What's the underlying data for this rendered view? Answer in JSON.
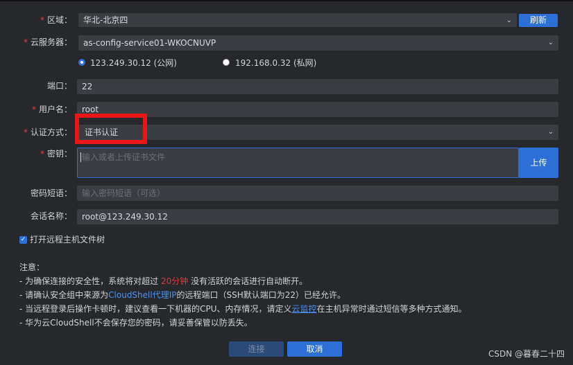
{
  "form": {
    "region": {
      "label": "区域：",
      "value": "华北-北京四",
      "refresh": "刷新"
    },
    "server": {
      "label": "云服务器：",
      "value": "as-config-service01-WKOCNUVP"
    },
    "ip_options": [
      {
        "label": "123.249.30.12 (公网)",
        "checked": true
      },
      {
        "label": "192.168.0.32 (私网)",
        "checked": false
      }
    ],
    "port": {
      "label": "端口：",
      "value": "22"
    },
    "username": {
      "label": "用户名：",
      "value": "root"
    },
    "auth": {
      "label": "认证方式：",
      "value": "证书认证"
    },
    "key": {
      "label": "密钥：",
      "placeholder": "输入或者上传证书文件",
      "upload": "上传"
    },
    "passphrase": {
      "label": "密码短语：",
      "placeholder": "输入密码短语（可选）"
    },
    "session": {
      "label": "会话名称：",
      "value": "root@123.249.30.12"
    },
    "open_tree": {
      "label": "打开远程主机文件树",
      "checked": true
    }
  },
  "notes": {
    "title": "注意：",
    "line1_a": "- 为确保连接的安全性，系统将对超过 ",
    "line1_b": "20分钟",
    "line1_c": " 没有活跃的会话进行自动断开。",
    "line2_a": "- 请确认安全组中来源为",
    "line2_b": "CloudShell代理IP",
    "line2_c": "的远程端口（SSH默认端口为22）已经允许。",
    "line3_a": "- 当远程登录后操作卡顿时，建议查看一下机器的CPU、内存情况，请定义",
    "line3_b": "云监控",
    "line3_c": "在主机异常时通过短信等多种方式通知。",
    "line4": "- 华为云CloudShell不会保存您的密码，请妥善保管以防丢失。"
  },
  "buttons": {
    "connect": "连接",
    "cancel": "取消"
  },
  "watermark": "CSDN @暮春二十四"
}
